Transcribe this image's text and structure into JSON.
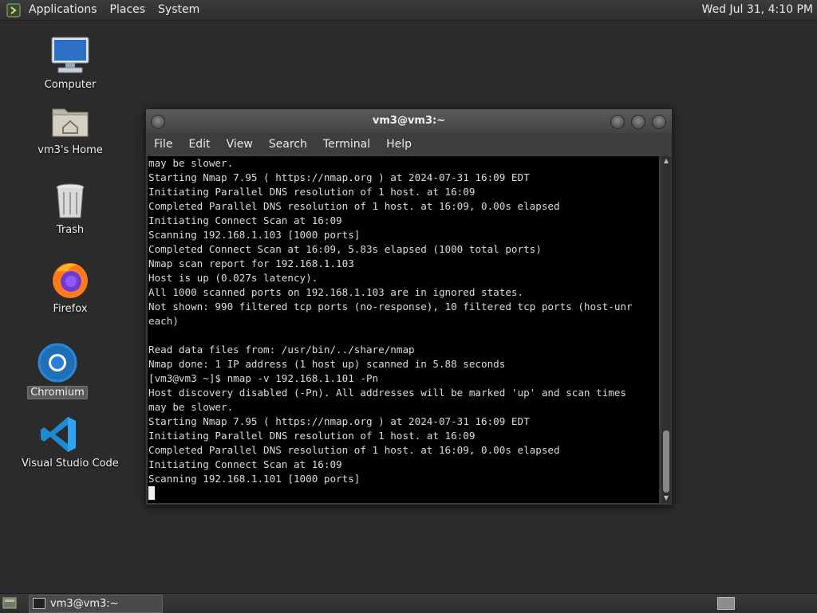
{
  "top_panel": {
    "menus": [
      "Applications",
      "Places",
      "System"
    ],
    "clock": "Wed Jul 31,  4:10 PM"
  },
  "desktop_icons": [
    {
      "label": "Computer",
      "icon": "computer-icon"
    },
    {
      "label": "vm3's Home",
      "icon": "home-folder-icon"
    },
    {
      "label": "Trash",
      "icon": "trash-icon"
    },
    {
      "label": "Firefox",
      "icon": "firefox-icon"
    },
    {
      "label": "Chromium",
      "icon": "chromium-icon",
      "selected": true
    },
    {
      "label": "Visual Studio Code",
      "icon": "vscode-icon"
    }
  ],
  "terminal": {
    "title": "vm3@vm3:~",
    "menu": [
      "File",
      "Edit",
      "View",
      "Search",
      "Terminal",
      "Help"
    ],
    "lines": [
      "may be slower.",
      "Starting Nmap 7.95 ( https://nmap.org ) at 2024-07-31 16:09 EDT",
      "Initiating Parallel DNS resolution of 1 host. at 16:09",
      "Completed Parallel DNS resolution of 1 host. at 16:09, 0.00s elapsed",
      "Initiating Connect Scan at 16:09",
      "Scanning 192.168.1.103 [1000 ports]",
      "Completed Connect Scan at 16:09, 5.83s elapsed (1000 total ports)",
      "Nmap scan report for 192.168.1.103",
      "Host is up (0.027s latency).",
      "All 1000 scanned ports on 192.168.1.103 are in ignored states.",
      "Not shown: 990 filtered tcp ports (no-response), 10 filtered tcp ports (host-unr",
      "each)",
      "",
      "Read data files from: /usr/bin/../share/nmap",
      "Nmap done: 1 IP address (1 host up) scanned in 5.88 seconds",
      "[vm3@vm3 ~]$ nmap -v 192.168.1.101 -Pn",
      "Host discovery disabled (-Pn). All addresses will be marked 'up' and scan times",
      "may be slower.",
      "Starting Nmap 7.95 ( https://nmap.org ) at 2024-07-31 16:09 EDT",
      "Initiating Parallel DNS resolution of 1 host. at 16:09",
      "Completed Parallel DNS resolution of 1 host. at 16:09, 0.00s elapsed",
      "Initiating Connect Scan at 16:09",
      "Scanning 192.168.1.101 [1000 ports]"
    ]
  },
  "taskbar": {
    "items": [
      {
        "label": "vm3@vm3:~"
      }
    ]
  }
}
